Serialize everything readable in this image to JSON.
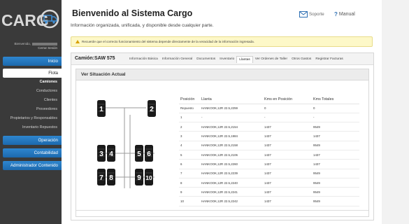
{
  "sidebar": {
    "logo_text": "CARG",
    "user_label": "Bienvenido,",
    "logout": "Cerrar Sesión",
    "nav": {
      "inicio": "Inicio",
      "flota": "Flota",
      "operacion": "Operación",
      "contabilidad": "Contabilidad",
      "admin": "Administrador Contenido"
    },
    "flota_items": [
      "Camiones",
      "Conductores",
      "Clientes",
      "Proveedores",
      "Propietarios y Responsables",
      "Inventario Repuestos"
    ]
  },
  "header": {
    "title": "Bienvenido al Sistema Cargo",
    "subtitle": "Información organizada, unificada, y disponible desde cualquier parte.",
    "soporte": "Soporte",
    "manual": "Manual"
  },
  "warning": "Recuerde que el correcto funcionamiento del sistema depende directamente de la veracidad de la información ingresada.",
  "panel": {
    "camion": "Camión:SAW 575",
    "tabs": [
      "Información Básica",
      "Información General",
      "Documentos",
      "Inventario",
      "Llantas",
      "Ver Ordenes de Taller",
      "Otros Gastos",
      "Registrar Facturas"
    ],
    "active_tab": "Llantas",
    "section_title": "Ver Situación Actual"
  },
  "tire_table": {
    "headers": [
      "Posición",
      "Llanta",
      "Kms en Posición",
      "Kms Totales"
    ],
    "rows": [
      [
        "Repuesto",
        "HANKOOK,12R 22.5,2259",
        "0",
        "0"
      ],
      [
        "1",
        "-",
        "-",
        "-"
      ],
      [
        "2",
        "HANKOOK,12R 22.5,2154",
        "1437",
        "9549"
      ],
      [
        "3",
        "HANKOOK,12R 22.5,1984",
        "1437",
        "1437"
      ],
      [
        "4",
        "HANKOOK,12R 22.5,2158",
        "1437",
        "9549"
      ],
      [
        "5",
        "HANKOOK,12R 22.5,2106",
        "1437",
        "1437"
      ],
      [
        "6",
        "HANKOOK,12R 22.5,2260",
        "1437",
        "1437"
      ],
      [
        "7",
        "HANKOOK,12R 22.5,2239",
        "1437",
        "9549"
      ],
      [
        "8",
        "HANKOOK,12R 22.5,2240",
        "1437",
        "9549"
      ],
      [
        "9",
        "HANKOOK,12R 22.5,2241",
        "1437",
        "9549"
      ],
      [
        "10",
        "HANKOOK,12R 22.5,2242",
        "1437",
        "9549"
      ]
    ]
  },
  "diagram_labels": [
    "1",
    "2",
    "3",
    "4",
    "5",
    "6",
    "7",
    "8",
    "9",
    "10"
  ],
  "colors": {
    "nav_blue": "#1c69ad",
    "sidebar_bg": "#3a3a3a",
    "warning_bg": "#fdf8c8",
    "tire": "#1a1a1a"
  }
}
